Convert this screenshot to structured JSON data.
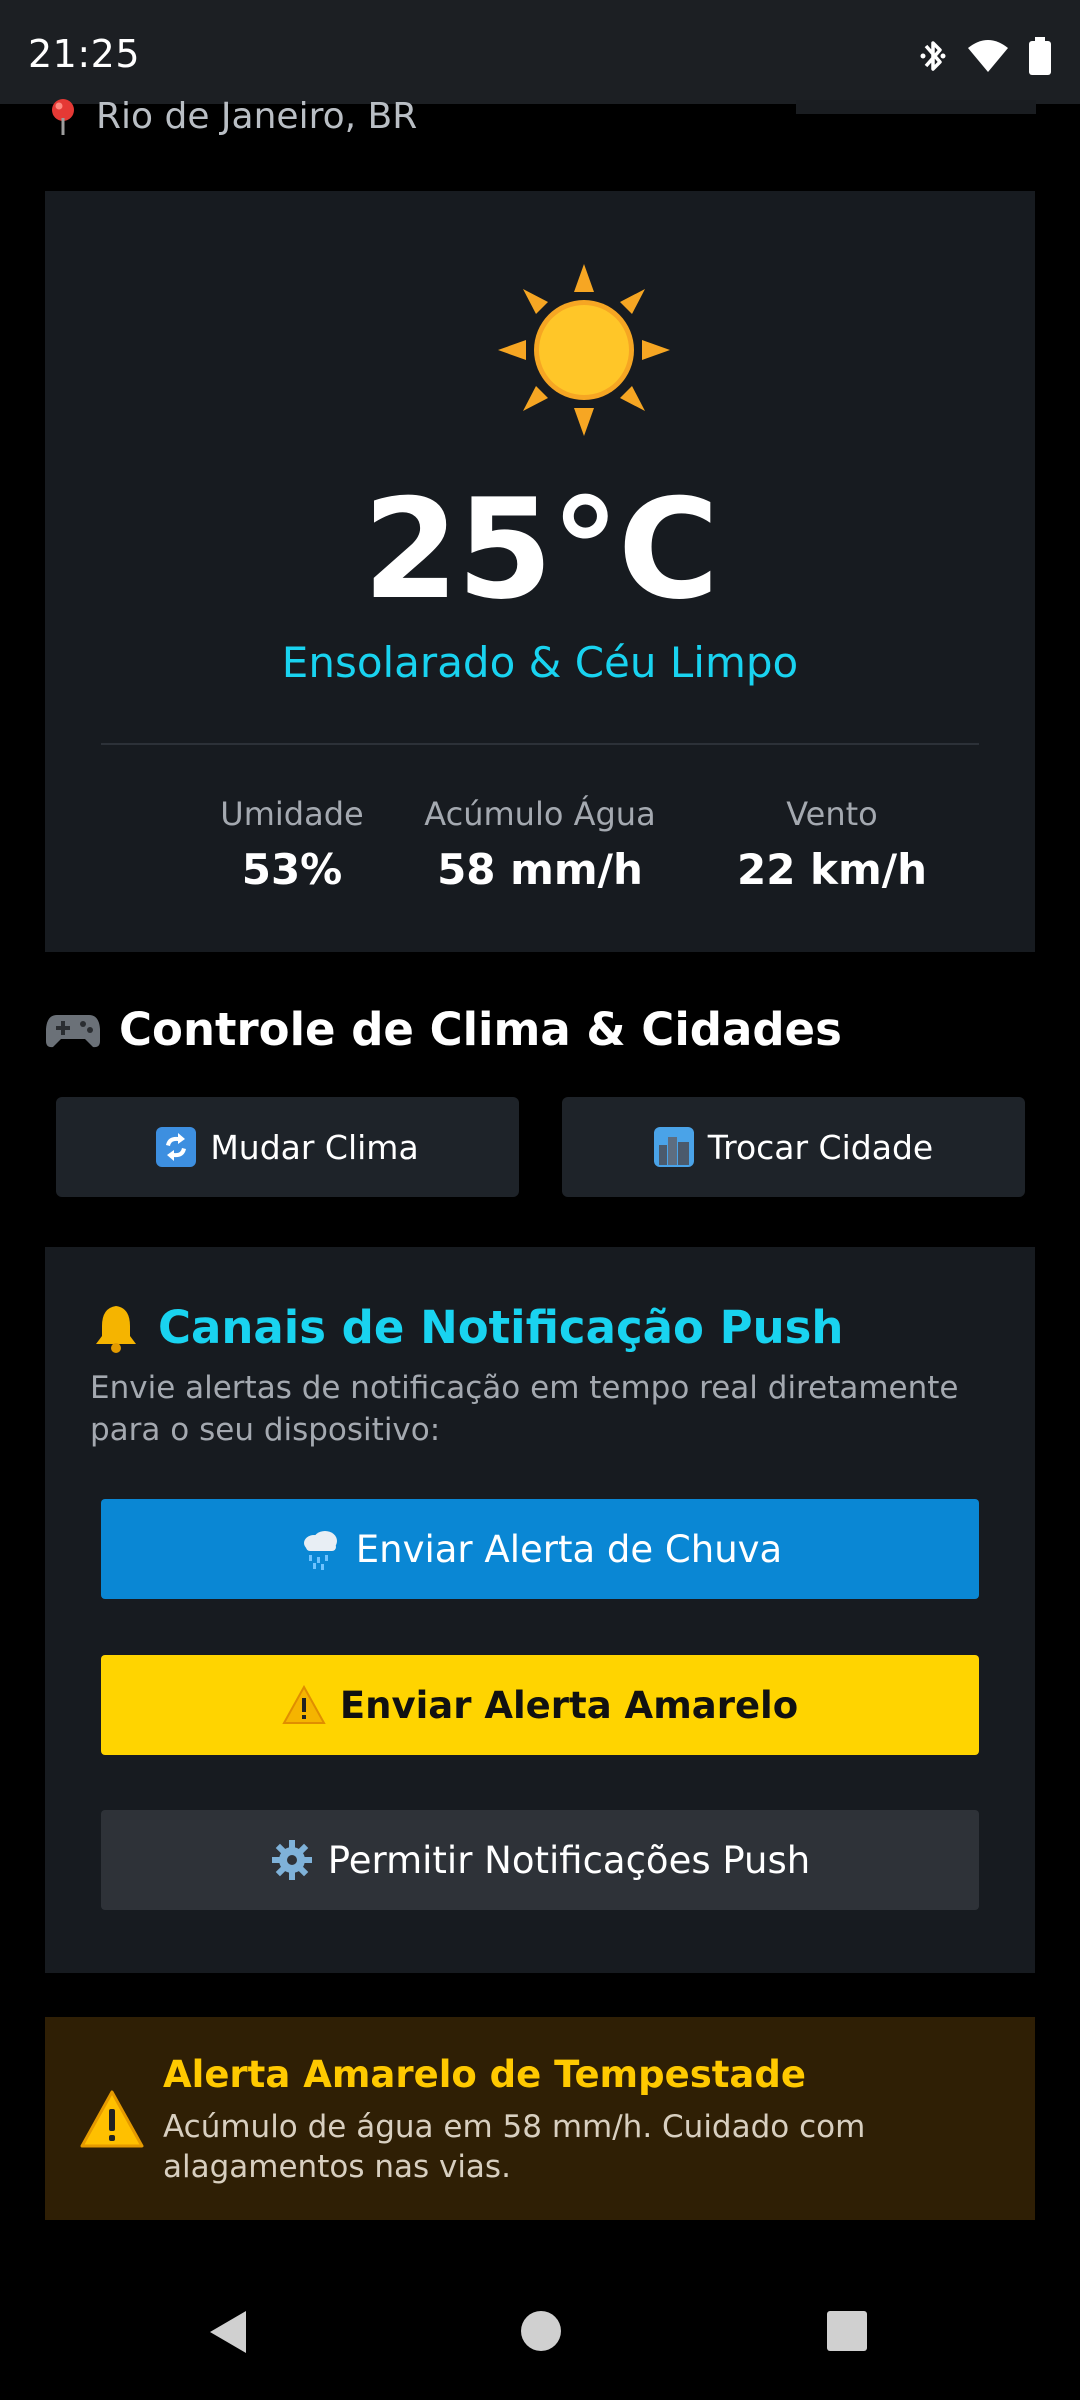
{
  "status_bar": {
    "time": "21:25"
  },
  "header": {
    "location": "Rio de Janeiro, BR"
  },
  "weather": {
    "temperature": "25°C",
    "condition": "Ensolarado & Céu Limpo",
    "stats": [
      {
        "label": "Umidade",
        "value": "53%"
      },
      {
        "label": "Acúmulo Água",
        "value": "58 mm/h"
      },
      {
        "label": "Vento",
        "value": "22 km/h"
      }
    ]
  },
  "controls": {
    "title": "Controle de Clima & Cidades",
    "change_weather_label": "Mudar Clima",
    "change_city_label": "Trocar Cidade"
  },
  "notifications": {
    "title": "Canais de Notificação Push",
    "description": "Envie alertas de notificação em tempo real diretamente para o seu dispositivo:",
    "rain_alert_label": "Enviar Alerta de Chuva",
    "yellow_alert_label": "Enviar Alerta Amarelo",
    "permit_label": "Permitir Notificações Push"
  },
  "alert": {
    "title": "Alerta Amarelo de Tempestade",
    "message": "Acúmulo de água em 58 mm/h. Cuidado com alagamentos nas vias."
  },
  "colors": {
    "accent_cyan": "#19d3f0",
    "rain_button": "#0a87d4",
    "yellow_button": "#ffd400",
    "alert_title": "#ffc900"
  }
}
